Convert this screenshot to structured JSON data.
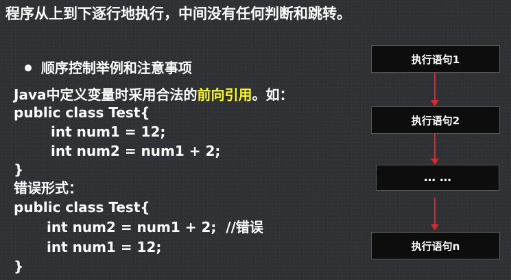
{
  "title": "程序从上到下逐行地执行，中间没有任何判断和跳转。",
  "bullet": "顺序控制举例和注意事项",
  "java_intro": {
    "prefix": "Java中定义变量时采用合法的",
    "highlight": "前向引用",
    "suffix": "。如："
  },
  "correct_code": [
    "public class Test{",
    "int num1 = 12;",
    "int num2 = num1 + 2;",
    "}"
  ],
  "error_label": "错误形式：",
  "error_code": [
    "public class Test{",
    "int num2 = num1 + 2;  //错误",
    "int num1 = 12;",
    "}"
  ],
  "flow": [
    "执行语句1",
    "执行语句2",
    "… …",
    "执行语句n"
  ],
  "colors": {
    "highlight": "#ffff00",
    "arrow": "#e0262a",
    "box": "#0d0d0d"
  }
}
